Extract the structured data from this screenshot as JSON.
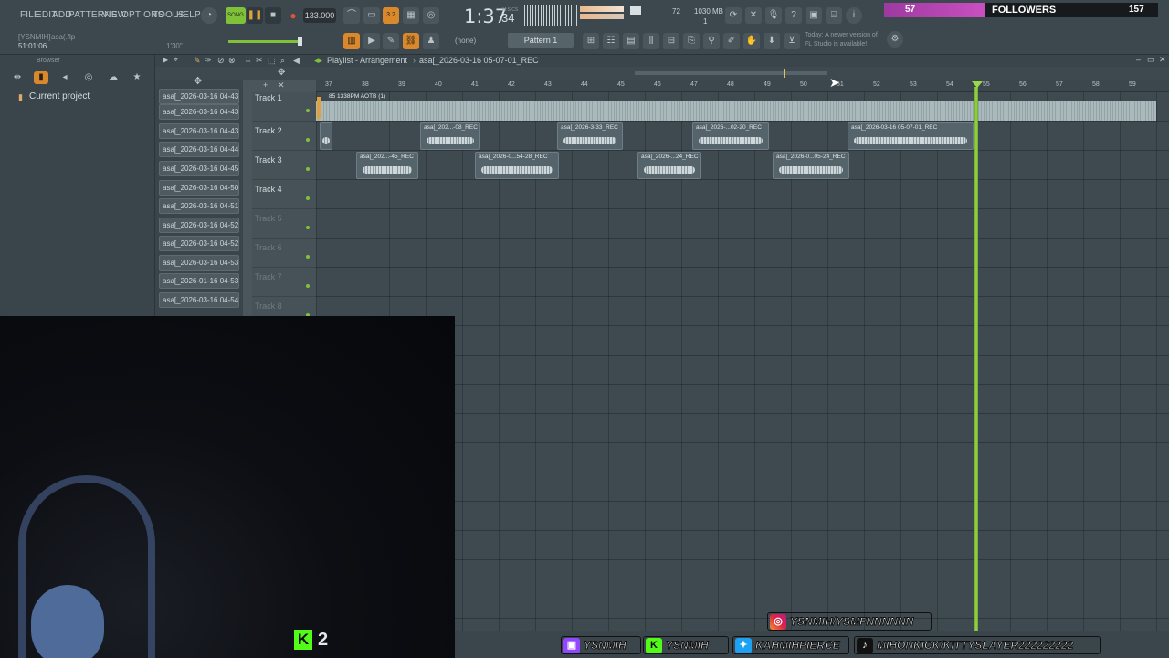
{
  "menu": [
    "FILE",
    "EDIT",
    "ADD",
    "PATTERNS",
    "VIEW",
    "OPTIONS",
    "TOOLS",
    "HELP"
  ],
  "project": {
    "user": "[YSNMIH]",
    "file": "asa(.flp",
    "time": "51:01:06",
    "duration": "1'30\""
  },
  "transport": {
    "song_label": "SONG",
    "tempo": "133.000",
    "time_display": "1:37",
    "time_sub": "34",
    "time_unit": "M:S:CS",
    "cpu": "72",
    "mem": "1030 MB",
    "voices": "1"
  },
  "pattern": {
    "none_label": "(none)",
    "pattern_name": "Pattern 1"
  },
  "news": {
    "line1": "Today:  A newer version of",
    "line2": "FL Studio is available!"
  },
  "followers": {
    "count_left": "57",
    "label": "FOLLOWERS",
    "count_right": "157"
  },
  "browser": {
    "title": "Browser",
    "current_project": "Current project"
  },
  "files": [
    "asa[_2026-03-16 04-43-...",
    "asa[_2026-03-16 04-43-...",
    "asa[_2026-03-16 04-43-...",
    "asa[_2026-03-16 04-44-...",
    "asa[_2026-03-16 04-45-...",
    "asa[_2026-03-16 04-50-...",
    "asa[_2026-03-16 04-51-...",
    "asa[_2026-03-16 04-52-...",
    "asa[_2026-03-16 04-52-...",
    "asa[_2026-03-16 04-53-...",
    "asa[_2026-01-16 04-53-...",
    "asa[_2026-03-16 04-54-..."
  ],
  "playlist": {
    "title": "Playlist - Arrangement",
    "file": "asa[_2026-03-16 05-07-01_REC"
  },
  "ruler": [
    "37",
    "38",
    "39",
    "40",
    "41",
    "42",
    "43",
    "44",
    "45",
    "46",
    "47",
    "48",
    "49",
    "50",
    "51",
    "52",
    "53",
    "54",
    "55",
    "56",
    "57",
    "58",
    "59"
  ],
  "tracks": [
    "Track 1",
    "Track 2",
    "Track 3",
    "Track 4",
    "Track 5",
    "Track 6",
    "Track 7",
    "Track 8"
  ],
  "track1_label": "85 1338PM AOTB (1)",
  "clips": [
    {
      "label": "asa[_202...-08_REC"
    },
    {
      "label": "asa[_2026-3-33_REC"
    },
    {
      "label": "asa[_2026-...02-20_REC"
    },
    {
      "label": "asa[_2026-03-16 05-07-01_REC"
    },
    {
      "label": "asa[_202...-45_REC"
    },
    {
      "label": "asa[_2026-0...54-28_REC"
    },
    {
      "label": "asa[_2026-...24_REC"
    },
    {
      "label": "asa[_2026-0...05-24_REC"
    }
  ],
  "kick": {
    "count": "2"
  },
  "socials": {
    "instagram": "YSNMIH/YSMFNNNNNN",
    "twitch": "YSNMIH",
    "kick": "YSNMIH",
    "twitter": "KAHMIHPIERCE",
    "tiktok": "MIHONKICK/KITTYSLAYER222222222"
  }
}
